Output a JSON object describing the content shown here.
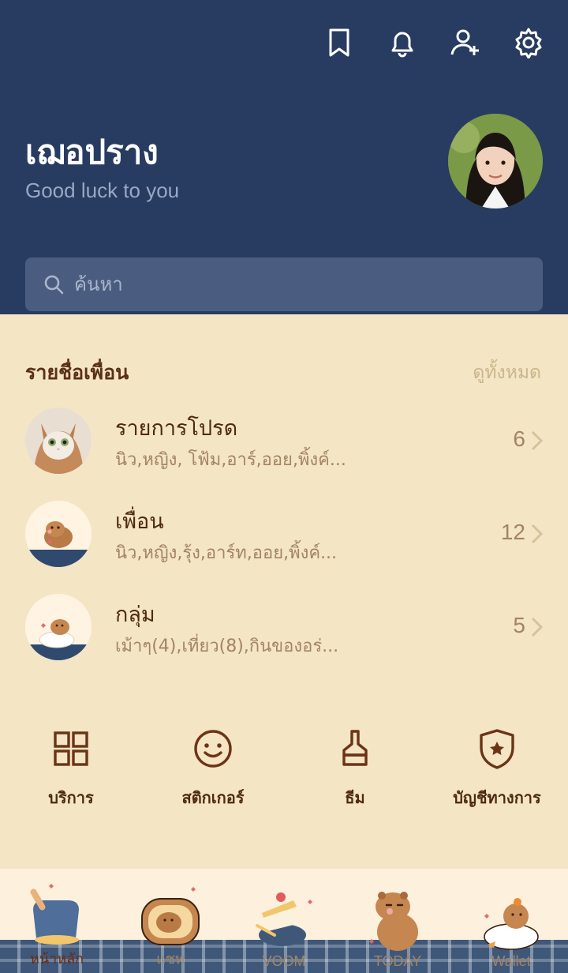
{
  "header": {
    "icons": [
      "bookmark-icon",
      "bell-icon",
      "add-friend-icon",
      "gear-icon"
    ],
    "profile_name": "เฌอปราง",
    "profile_status": "Good luck to you"
  },
  "search": {
    "placeholder": "ค้นหา"
  },
  "friends_section": {
    "title": "รายชื่อเพื่อน",
    "see_all": "ดูทั้งหมด",
    "rows": [
      {
        "title": "รายการโปรด",
        "subtitle": "นิว,หญิง, โฟ้ม,อาร์,ออย,พิ้งค์...",
        "count": "6"
      },
      {
        "title": "เพื่อน",
        "subtitle": "นิว,หญิง,รุ้ง,อาร์ท,ออย,พิ้งค์...",
        "count": "12"
      },
      {
        "title": "กลุ่ม",
        "subtitle": "เม้าๆ(4),เที่ยว(8),กินของอร่...",
        "count": "5"
      }
    ]
  },
  "services": [
    {
      "label": "บริการ",
      "icon": "grid-icon"
    },
    {
      "label": "สติกเกอร์",
      "icon": "smiley-icon"
    },
    {
      "label": "ธีม",
      "icon": "brush-icon"
    },
    {
      "label": "บัญชีทางการ",
      "icon": "shield-star-icon"
    }
  ],
  "bottom_nav": [
    {
      "label": "หน้าหลัก",
      "active": true
    },
    {
      "label": "แชท",
      "active": false
    },
    {
      "label": "VOOM",
      "active": false
    },
    {
      "label": "TODAY",
      "active": false
    },
    {
      "label": "Wallet",
      "active": false
    }
  ],
  "colors": {
    "header_bg": "#283b61",
    "body_bg": "#f4e5c5",
    "text_brown": "#4e2a12",
    "muted_brown": "#a38463"
  }
}
